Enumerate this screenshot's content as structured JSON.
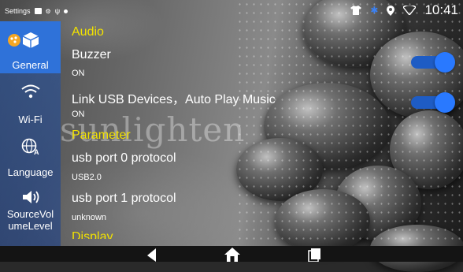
{
  "status_bar": {
    "app_label": "Settings",
    "time": "10:41"
  },
  "sidebar": {
    "items": [
      {
        "label": "General",
        "icon": "general-icon",
        "active": true
      },
      {
        "label": "Wi-Fi",
        "icon": "wifi-icon",
        "active": false
      },
      {
        "label": "Language",
        "icon": "language-icon",
        "active": false
      },
      {
        "label": "SourceVolumeLevel",
        "label_line1": "SourceVol",
        "label_line2": "umeLevel",
        "icon": "volume-icon",
        "active": false
      }
    ]
  },
  "content": {
    "audio_header": "Audio",
    "buzzer": {
      "title": "Buzzer",
      "value": "ON",
      "enabled": true
    },
    "link_usb": {
      "title": "Link USB Devices，Auto Play Music",
      "value": "ON",
      "enabled": true
    },
    "parameter_header": "Parameter",
    "usb0": {
      "title": "usb port 0 protocol",
      "value": "USB2.0"
    },
    "usb1": {
      "title": "usb port 1 protocol",
      "value": "unknown"
    },
    "display_header": "Display"
  },
  "watermark": "sunlighten",
  "colors": {
    "accent": "#2979ff",
    "section_header": "#f2e200",
    "sidebar_active": "#2f72d9"
  },
  "navbar": {
    "buttons": [
      "back-icon",
      "home-icon",
      "recents-icon"
    ]
  }
}
